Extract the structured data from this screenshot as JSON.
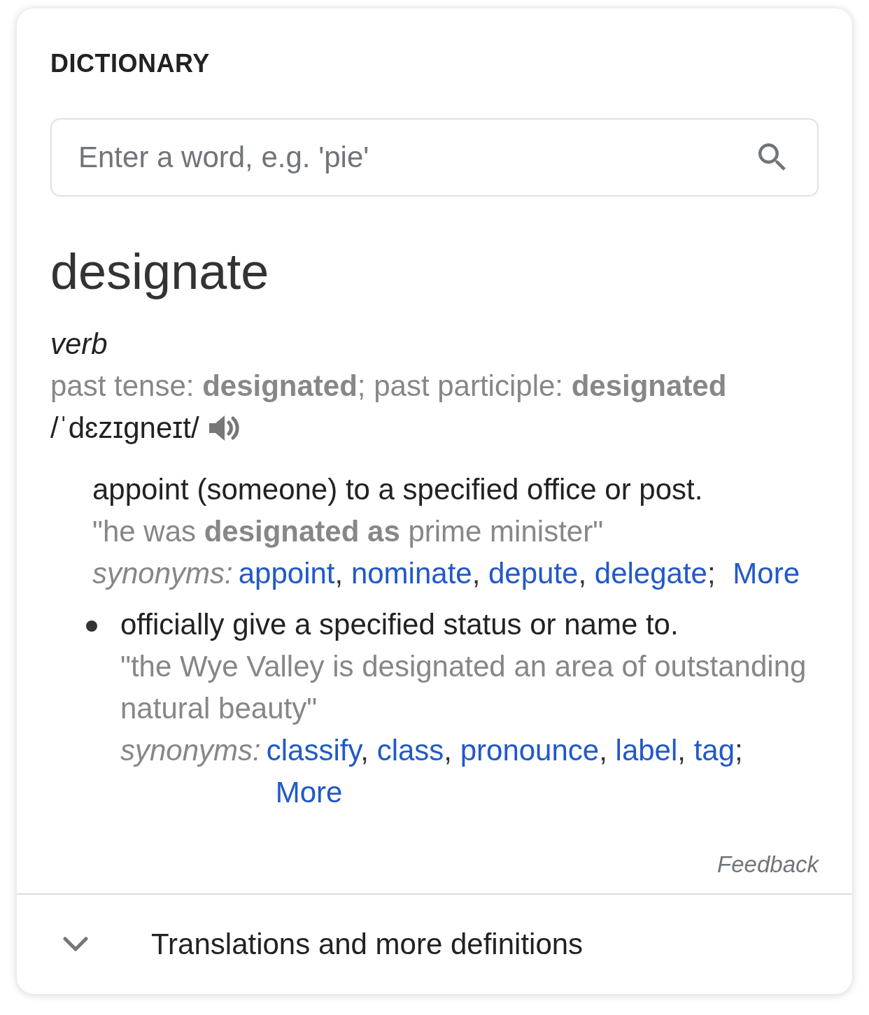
{
  "header": {
    "title": "DICTIONARY"
  },
  "search": {
    "placeholder": "Enter a word, e.g. 'pie'"
  },
  "entry": {
    "word": "designate",
    "part_of_speech": "verb",
    "forms": "past tense: **designated**; past participle: **designated**",
    "pronunciation": "/ˈdɛzɪɡneɪt/"
  },
  "senses": [
    {
      "kind": "primary",
      "definition": "appoint (someone) to a specified office or post.",
      "example": "\"he was **designated as** prime minister\"",
      "synonyms_label": "synonyms:",
      "synonyms": [
        {
          "word": "appoint",
          "separator": ","
        },
        {
          "word": "nominate",
          "separator": ","
        },
        {
          "word": "depute",
          "separator": ","
        },
        {
          "word": "delegate",
          "separator": ";"
        }
      ],
      "more": "More"
    },
    {
      "kind": "sub",
      "definition": "officially give a specified status or name to.",
      "example": "\"the Wye Valley is designated an area of outstanding natural beauty\"",
      "synonyms_label": "synonyms:",
      "synonyms": [
        {
          "word": "classify",
          "separator": ","
        },
        {
          "word": "class",
          "separator": ","
        },
        {
          "word": "pronounce",
          "separator": ","
        },
        {
          "word": "label",
          "separator": ","
        },
        {
          "word": "tag",
          "separator": ";"
        }
      ],
      "more": "More"
    }
  ],
  "feedback": "Feedback",
  "expander": {
    "label": "Translations and more definitions",
    "expanded": false
  }
}
